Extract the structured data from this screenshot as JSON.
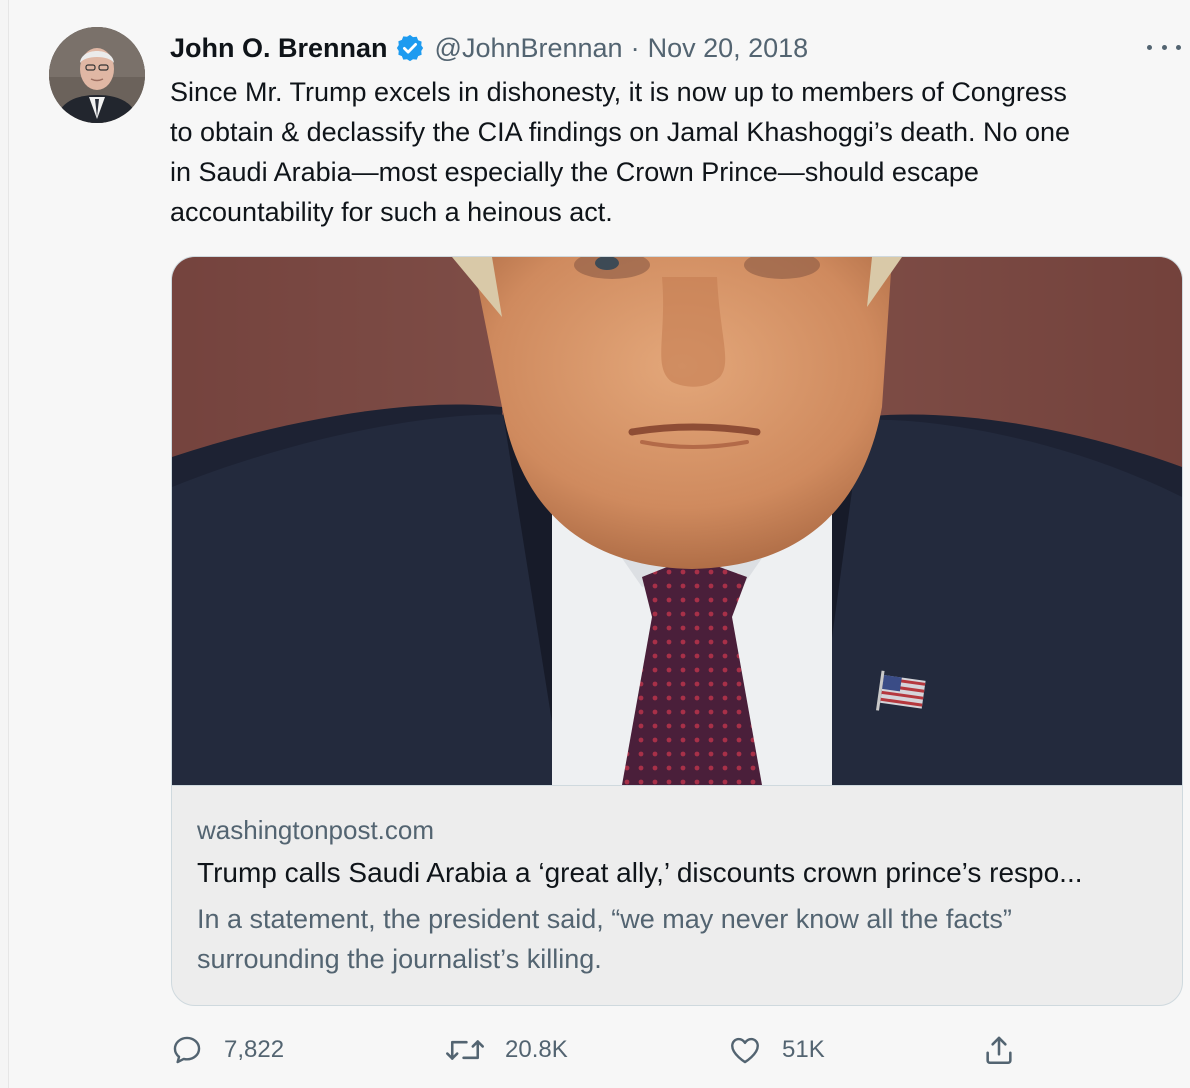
{
  "tweet": {
    "author_name": "John O. Brennan",
    "verified": true,
    "handle": "@JohnBrennan",
    "separator": "·",
    "date": "Nov 20, 2018",
    "text": "Since Mr. Trump excels in dishonesty, it is now up to members of Congress\nto obtain & declassify the CIA findings on Jamal Khashoggi’s death. No one\nin Saudi Arabia—most especially the Crown Prince—should escape\naccountability for such a heinous act.",
    "card": {
      "domain": "washingtonpost.com",
      "title": "Trump calls Saudi Arabia a ‘great ally,’ discounts crown prince’s respo...",
      "description": "In a statement, the president said, “we may never know all the facts” surrounding the journalist’s killing."
    },
    "actions": {
      "reply_count": "7,822",
      "retweet_count": "20.8K",
      "like_count": "51K"
    }
  },
  "icons": {
    "verified": "verified-badge-icon",
    "more": "more-options-icon",
    "reply": "reply-icon",
    "retweet": "retweet-icon",
    "like": "heart-icon",
    "share": "share-icon"
  },
  "colors": {
    "accent": "#1d9bf0",
    "text_primary": "#0f1419",
    "text_secondary": "#536471",
    "border": "#cfd9de"
  }
}
